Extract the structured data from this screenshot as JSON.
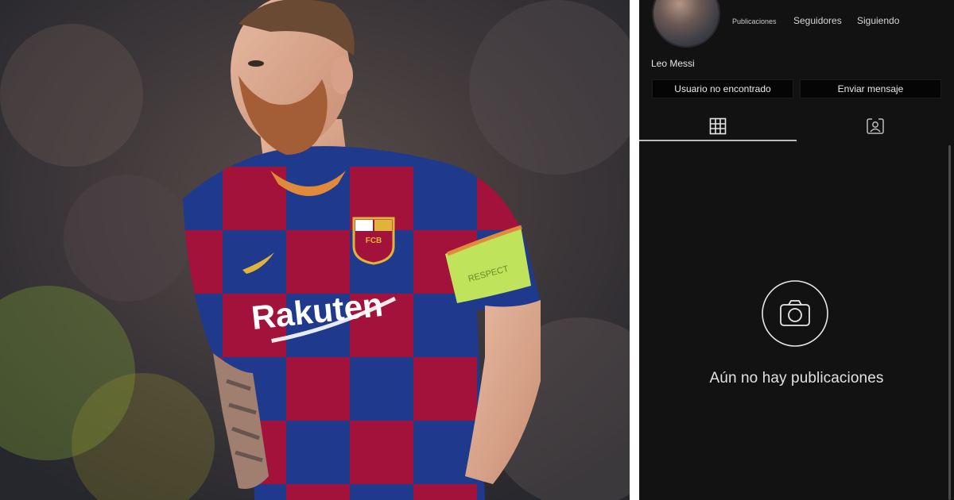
{
  "photo": {
    "sponsor": "Rakuten",
    "crest_text": "FCB",
    "armband_text": "RESPECT"
  },
  "profile": {
    "stats": [
      {
        "label": "Publicaciones"
      },
      {
        "label": "Seguidores"
      },
      {
        "label": "Siguiendo"
      }
    ],
    "username": "Leo Messi",
    "buttons": {
      "not_found": "Usuario no encontrado",
      "send_message": "Enviar mensaje"
    },
    "tabs": [
      {
        "icon": "grid-icon",
        "active": true
      },
      {
        "icon": "tagged-person-icon",
        "active": false
      }
    ],
    "empty_state": {
      "icon": "camera-icon",
      "text": "Aún no hay publicaciones"
    }
  },
  "colors": {
    "profile_bg": "#121212",
    "button_bg": "#050505",
    "text": "#e9e9e9",
    "jersey_blue": "#1f3a8c",
    "jersey_red": "#a3123a"
  }
}
